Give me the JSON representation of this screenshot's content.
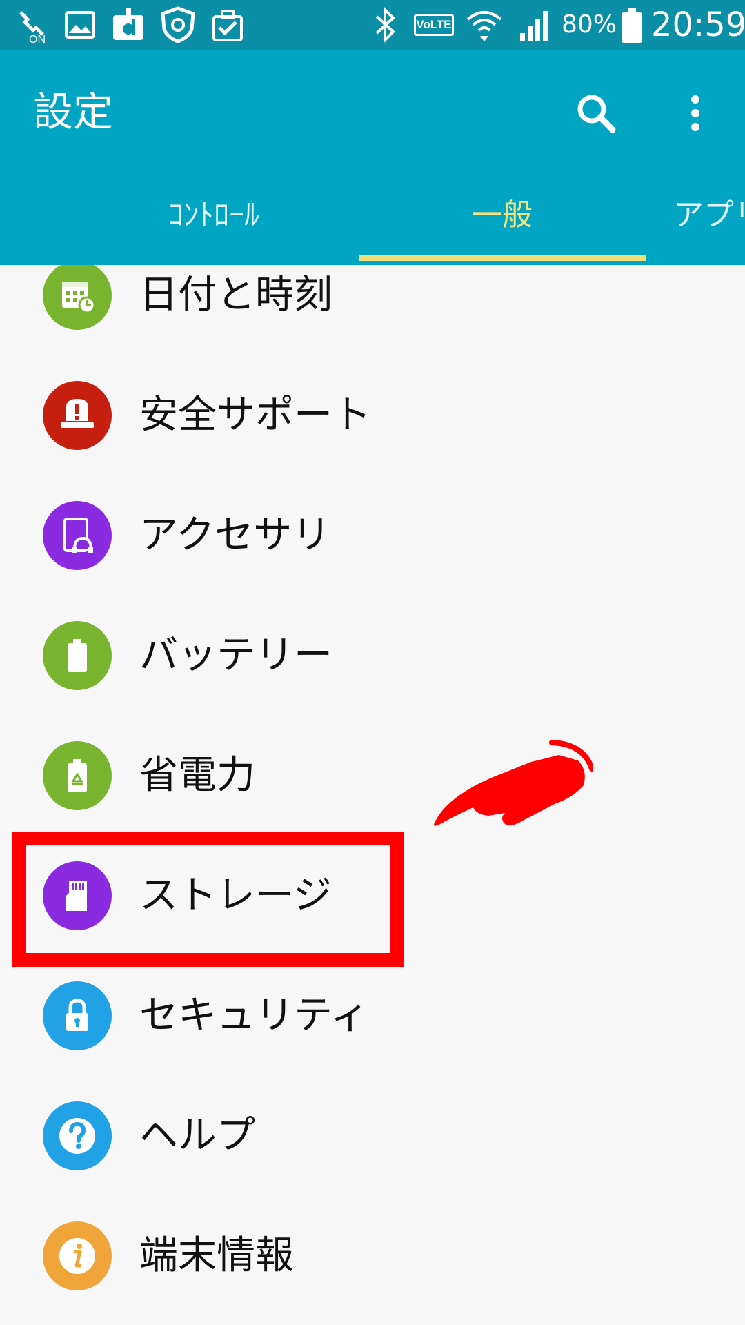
{
  "status_bar": {
    "battery_percent": "80%",
    "time": "20:59",
    "volte": "VoLTE",
    "icons": [
      "signal-on-icon",
      "image-icon",
      "docomo-icon",
      "shield-icon",
      "clipboard-check-icon",
      "bluetooth-icon",
      "volte-icon",
      "wifi-icon",
      "cell-signal-icon",
      "battery-icon"
    ]
  },
  "app_bar": {
    "title": "設定",
    "search_icon": "search-icon",
    "more_icon": "more-vert-icon",
    "tabs": [
      {
        "label": "ｺﾝﾄﾛｰﾙ",
        "active": false
      },
      {
        "label": "一般",
        "active": true
      },
      {
        "label": "アプリ",
        "active": false
      }
    ]
  },
  "settings_list": [
    {
      "label": "日付と時刻",
      "icon": "calendar-clock-icon",
      "color": "#78b42e"
    },
    {
      "label": "安全サポート",
      "icon": "alarm-light-icon",
      "color": "#c61f10"
    },
    {
      "label": "アクセサリ",
      "icon": "accessory-headset-icon",
      "color": "#8a2be2"
    },
    {
      "label": "バッテリー",
      "icon": "battery-icon",
      "color": "#78b42e"
    },
    {
      "label": "省電力",
      "icon": "battery-recycle-icon",
      "color": "#78b42e"
    },
    {
      "label": "ストレージ",
      "icon": "sd-card-icon",
      "color": "#8a2be2"
    },
    {
      "label": "セキュリティ",
      "icon": "lock-icon",
      "color": "#22a2e6"
    },
    {
      "label": "ヘルプ",
      "icon": "help-icon",
      "color": "#22a2e6"
    },
    {
      "label": "端末情報",
      "icon": "info-icon",
      "color": "#f0a53a"
    }
  ],
  "annotation": {
    "highlight_color": "#ff0000",
    "highlighted_item": "ストレージ"
  }
}
